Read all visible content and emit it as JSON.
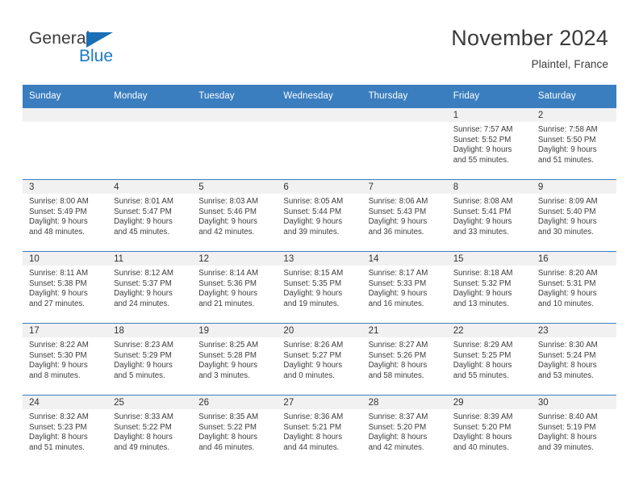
{
  "brand": {
    "name_top": "General",
    "name_bottom": "Blue",
    "triangle_icon": "brand-triangle-icon",
    "color_blue": "#1a7ac4",
    "color_triangle": "#1a6fb5"
  },
  "header": {
    "month_title": "November 2024",
    "location": "Plaintel, France"
  },
  "theme": {
    "header_bg": "#3a7ebf",
    "daynum_bg": "#f1f1f1",
    "cell_bg": "#ffffff",
    "text": "#3d3d3d"
  },
  "calendar": {
    "weekday_headers": [
      "Sunday",
      "Monday",
      "Tuesday",
      "Wednesday",
      "Thursday",
      "Friday",
      "Saturday"
    ],
    "weeks": [
      [
        {
          "day": "",
          "sunrise": "",
          "sunset": "",
          "daylight_line1": "",
          "daylight_line2": ""
        },
        {
          "day": "",
          "sunrise": "",
          "sunset": "",
          "daylight_line1": "",
          "daylight_line2": ""
        },
        {
          "day": "",
          "sunrise": "",
          "sunset": "",
          "daylight_line1": "",
          "daylight_line2": ""
        },
        {
          "day": "",
          "sunrise": "",
          "sunset": "",
          "daylight_line1": "",
          "daylight_line2": ""
        },
        {
          "day": "",
          "sunrise": "",
          "sunset": "",
          "daylight_line1": "",
          "daylight_line2": ""
        },
        {
          "day": "1",
          "sunrise": "Sunrise: 7:57 AM",
          "sunset": "Sunset: 5:52 PM",
          "daylight_line1": "Daylight: 9 hours",
          "daylight_line2": "and 55 minutes."
        },
        {
          "day": "2",
          "sunrise": "Sunrise: 7:58 AM",
          "sunset": "Sunset: 5:50 PM",
          "daylight_line1": "Daylight: 9 hours",
          "daylight_line2": "and 51 minutes."
        }
      ],
      [
        {
          "day": "3",
          "sunrise": "Sunrise: 8:00 AM",
          "sunset": "Sunset: 5:49 PM",
          "daylight_line1": "Daylight: 9 hours",
          "daylight_line2": "and 48 minutes."
        },
        {
          "day": "4",
          "sunrise": "Sunrise: 8:01 AM",
          "sunset": "Sunset: 5:47 PM",
          "daylight_line1": "Daylight: 9 hours",
          "daylight_line2": "and 45 minutes."
        },
        {
          "day": "5",
          "sunrise": "Sunrise: 8:03 AM",
          "sunset": "Sunset: 5:46 PM",
          "daylight_line1": "Daylight: 9 hours",
          "daylight_line2": "and 42 minutes."
        },
        {
          "day": "6",
          "sunrise": "Sunrise: 8:05 AM",
          "sunset": "Sunset: 5:44 PM",
          "daylight_line1": "Daylight: 9 hours",
          "daylight_line2": "and 39 minutes."
        },
        {
          "day": "7",
          "sunrise": "Sunrise: 8:06 AM",
          "sunset": "Sunset: 5:43 PM",
          "daylight_line1": "Daylight: 9 hours",
          "daylight_line2": "and 36 minutes."
        },
        {
          "day": "8",
          "sunrise": "Sunrise: 8:08 AM",
          "sunset": "Sunset: 5:41 PM",
          "daylight_line1": "Daylight: 9 hours",
          "daylight_line2": "and 33 minutes."
        },
        {
          "day": "9",
          "sunrise": "Sunrise: 8:09 AM",
          "sunset": "Sunset: 5:40 PM",
          "daylight_line1": "Daylight: 9 hours",
          "daylight_line2": "and 30 minutes."
        }
      ],
      [
        {
          "day": "10",
          "sunrise": "Sunrise: 8:11 AM",
          "sunset": "Sunset: 5:38 PM",
          "daylight_line1": "Daylight: 9 hours",
          "daylight_line2": "and 27 minutes."
        },
        {
          "day": "11",
          "sunrise": "Sunrise: 8:12 AM",
          "sunset": "Sunset: 5:37 PM",
          "daylight_line1": "Daylight: 9 hours",
          "daylight_line2": "and 24 minutes."
        },
        {
          "day": "12",
          "sunrise": "Sunrise: 8:14 AM",
          "sunset": "Sunset: 5:36 PM",
          "daylight_line1": "Daylight: 9 hours",
          "daylight_line2": "and 21 minutes."
        },
        {
          "day": "13",
          "sunrise": "Sunrise: 8:15 AM",
          "sunset": "Sunset: 5:35 PM",
          "daylight_line1": "Daylight: 9 hours",
          "daylight_line2": "and 19 minutes."
        },
        {
          "day": "14",
          "sunrise": "Sunrise: 8:17 AM",
          "sunset": "Sunset: 5:33 PM",
          "daylight_line1": "Daylight: 9 hours",
          "daylight_line2": "and 16 minutes."
        },
        {
          "day": "15",
          "sunrise": "Sunrise: 8:18 AM",
          "sunset": "Sunset: 5:32 PM",
          "daylight_line1": "Daylight: 9 hours",
          "daylight_line2": "and 13 minutes."
        },
        {
          "day": "16",
          "sunrise": "Sunrise: 8:20 AM",
          "sunset": "Sunset: 5:31 PM",
          "daylight_line1": "Daylight: 9 hours",
          "daylight_line2": "and 10 minutes."
        }
      ],
      [
        {
          "day": "17",
          "sunrise": "Sunrise: 8:22 AM",
          "sunset": "Sunset: 5:30 PM",
          "daylight_line1": "Daylight: 9 hours",
          "daylight_line2": "and 8 minutes."
        },
        {
          "day": "18",
          "sunrise": "Sunrise: 8:23 AM",
          "sunset": "Sunset: 5:29 PM",
          "daylight_line1": "Daylight: 9 hours",
          "daylight_line2": "and 5 minutes."
        },
        {
          "day": "19",
          "sunrise": "Sunrise: 8:25 AM",
          "sunset": "Sunset: 5:28 PM",
          "daylight_line1": "Daylight: 9 hours",
          "daylight_line2": "and 3 minutes."
        },
        {
          "day": "20",
          "sunrise": "Sunrise: 8:26 AM",
          "sunset": "Sunset: 5:27 PM",
          "daylight_line1": "Daylight: 9 hours",
          "daylight_line2": "and 0 minutes."
        },
        {
          "day": "21",
          "sunrise": "Sunrise: 8:27 AM",
          "sunset": "Sunset: 5:26 PM",
          "daylight_line1": "Daylight: 8 hours",
          "daylight_line2": "and 58 minutes."
        },
        {
          "day": "22",
          "sunrise": "Sunrise: 8:29 AM",
          "sunset": "Sunset: 5:25 PM",
          "daylight_line1": "Daylight: 8 hours",
          "daylight_line2": "and 55 minutes."
        },
        {
          "day": "23",
          "sunrise": "Sunrise: 8:30 AM",
          "sunset": "Sunset: 5:24 PM",
          "daylight_line1": "Daylight: 8 hours",
          "daylight_line2": "and 53 minutes."
        }
      ],
      [
        {
          "day": "24",
          "sunrise": "Sunrise: 8:32 AM",
          "sunset": "Sunset: 5:23 PM",
          "daylight_line1": "Daylight: 8 hours",
          "daylight_line2": "and 51 minutes."
        },
        {
          "day": "25",
          "sunrise": "Sunrise: 8:33 AM",
          "sunset": "Sunset: 5:22 PM",
          "daylight_line1": "Daylight: 8 hours",
          "daylight_line2": "and 49 minutes."
        },
        {
          "day": "26",
          "sunrise": "Sunrise: 8:35 AM",
          "sunset": "Sunset: 5:22 PM",
          "daylight_line1": "Daylight: 8 hours",
          "daylight_line2": "and 46 minutes."
        },
        {
          "day": "27",
          "sunrise": "Sunrise: 8:36 AM",
          "sunset": "Sunset: 5:21 PM",
          "daylight_line1": "Daylight: 8 hours",
          "daylight_line2": "and 44 minutes."
        },
        {
          "day": "28",
          "sunrise": "Sunrise: 8:37 AM",
          "sunset": "Sunset: 5:20 PM",
          "daylight_line1": "Daylight: 8 hours",
          "daylight_line2": "and 42 minutes."
        },
        {
          "day": "29",
          "sunrise": "Sunrise: 8:39 AM",
          "sunset": "Sunset: 5:20 PM",
          "daylight_line1": "Daylight: 8 hours",
          "daylight_line2": "and 40 minutes."
        },
        {
          "day": "30",
          "sunrise": "Sunrise: 8:40 AM",
          "sunset": "Sunset: 5:19 PM",
          "daylight_line1": "Daylight: 8 hours",
          "daylight_line2": "and 39 minutes."
        }
      ]
    ]
  }
}
